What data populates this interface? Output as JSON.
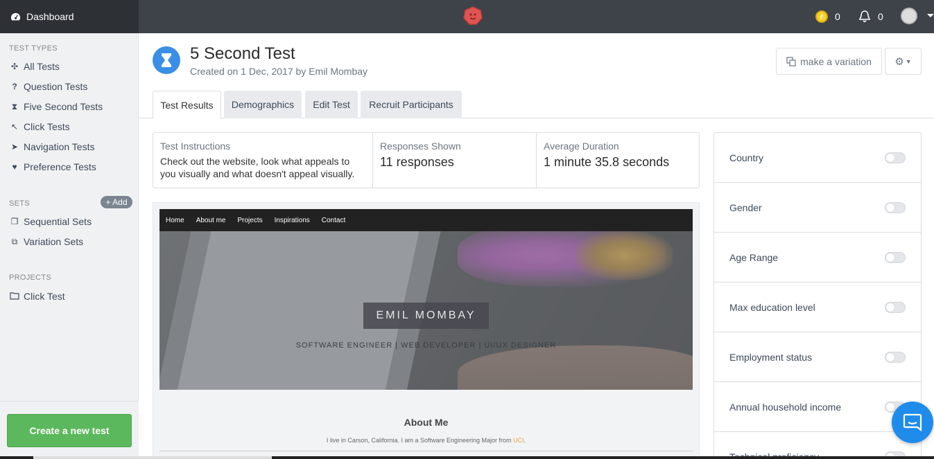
{
  "topbar": {
    "brand_label": "Dashboard",
    "coins_count": "0",
    "notifications_count": "0"
  },
  "sidebar": {
    "test_types_heading": "TEST TYPES",
    "test_types": [
      {
        "label": "All Tests",
        "icon": "cluster-icon"
      },
      {
        "label": "Question Tests",
        "icon": "question-icon"
      },
      {
        "label": "Five Second Tests",
        "icon": "hourglass-icon"
      },
      {
        "label": "Click Tests",
        "icon": "cursor-icon"
      },
      {
        "label": "Navigation Tests",
        "icon": "navigation-arrow-icon"
      },
      {
        "label": "Preference Tests",
        "icon": "heart-icon"
      }
    ],
    "sets_heading": "SETS",
    "add_label": "+ Add",
    "sets": [
      {
        "label": "Sequential Sets",
        "icon": "copy-icon"
      },
      {
        "label": "Variation Sets",
        "icon": "variation-icon"
      }
    ],
    "projects_heading": "PROJECTS",
    "projects": [
      {
        "label": "Click Test",
        "icon": "folder-icon"
      }
    ],
    "create_button": "Create a new test"
  },
  "header": {
    "title": "5 Second Test",
    "subtitle": "Created on 1 Dec, 2017 by Emil Mombay",
    "variation_button": "make a variation"
  },
  "tabs": [
    "Test Results",
    "Demographics",
    "Edit Test",
    "Recruit Participants"
  ],
  "active_tab": "Test Results",
  "stats": {
    "instructions_label": "Test Instructions",
    "instructions_text": "Check out the website, look what appeals to you visually and what doesn't appeal visually.",
    "responses_label": "Responses Shown",
    "responses_value": "11 responses",
    "duration_label": "Average Duration",
    "duration_value": "1 minute 35.8 seconds"
  },
  "preview": {
    "nav": [
      "Home",
      "About me",
      "Projects",
      "Inspirations",
      "Contact"
    ],
    "hero_name": "EMIL MOMBAY",
    "hero_role": "SOFTWARE ENGINEER | WEB DEVELOPER | UI/UX DESIGNER",
    "about_title": "About Me",
    "about_text": "I live in Carson, California. I am a Software Engineering Major from ",
    "about_highlight": "UCI",
    "about_tail": "."
  },
  "filters": [
    {
      "label": "Country",
      "enabled": false
    },
    {
      "label": "Gender",
      "enabled": false
    },
    {
      "label": "Age Range",
      "enabled": false
    },
    {
      "label": "Max education level",
      "enabled": false
    },
    {
      "label": "Employment status",
      "enabled": false
    },
    {
      "label": "Annual household income",
      "enabled": false
    },
    {
      "label": "Technical proficiency",
      "enabled": false
    }
  ],
  "colors": {
    "topbar": "#3e4349",
    "accent_blue": "#3a8ee6",
    "create_green": "#5cb85c",
    "chat_blue": "#1f8ceb"
  }
}
